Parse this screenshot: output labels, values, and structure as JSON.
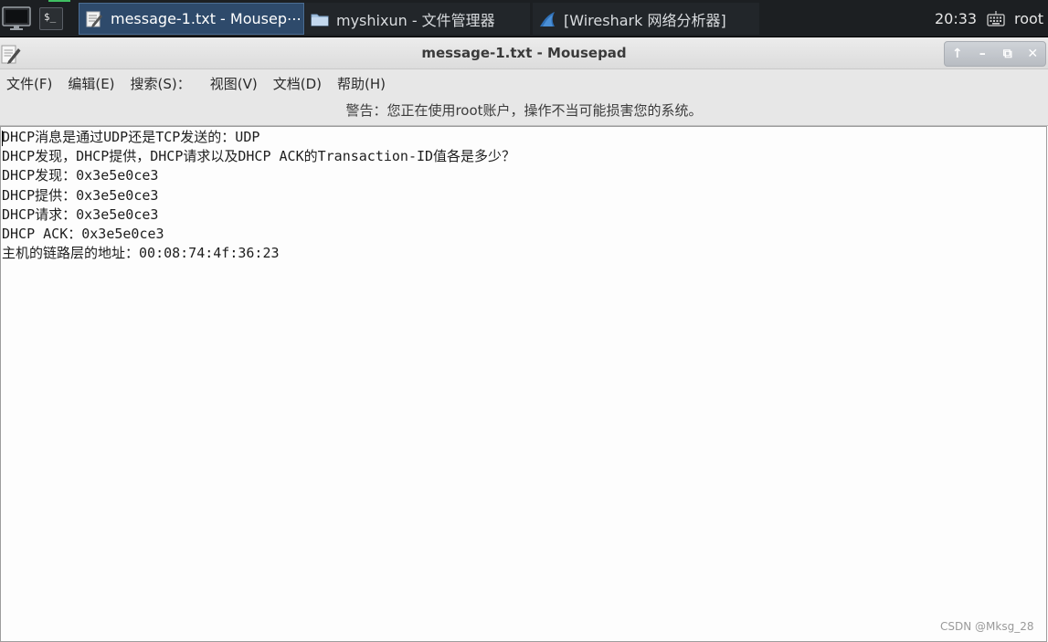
{
  "taskbar": {
    "tasks": [
      {
        "label": "message-1.txt - Mousep⋯",
        "icon": "text-editor-icon",
        "active": true
      },
      {
        "label": "myshixun - 文件管理器",
        "icon": "folder-icon",
        "active": false
      },
      {
        "label": "[Wireshark 网络分析器]",
        "icon": "wireshark-fin-icon",
        "active": false
      }
    ],
    "clock": "20:33",
    "user": "root",
    "terminal_glyph": "$_"
  },
  "window": {
    "title": "message-1.txt - Mousepad",
    "controls": {
      "up": "↑",
      "minimize": "–",
      "restore": "⧉",
      "close": "✕"
    }
  },
  "menu": {
    "items": [
      "文件(F)",
      "编辑(E)",
      "搜索(S)：",
      "视图(V)",
      "文档(D)",
      "帮助(H)"
    ]
  },
  "warning": "警告：您正在使用root账户，操作不当可能损害您的系统。",
  "document": {
    "lines": [
      "DHCP消息是通过UDP还是TCP发送的：UDP",
      "DHCP发现，DHCP提供，DHCP请求以及DHCP ACK的Transaction-ID值各是多少？",
      "DHCP发现：0x3e5e0ce3",
      "DHCP提供：0x3e5e0ce3",
      "DHCP请求：0x3e5e0ce3",
      "DHCP ACK：0x3e5e0ce3",
      "主机的链路层的地址：00:08:74:4f:36:23"
    ]
  },
  "watermark": "CSDN @Mksg_28",
  "colors": {
    "taskbar_bg": "#1c1f22",
    "active_task_bg": "#2e4a6b",
    "accent_green": "#3fbf62"
  }
}
